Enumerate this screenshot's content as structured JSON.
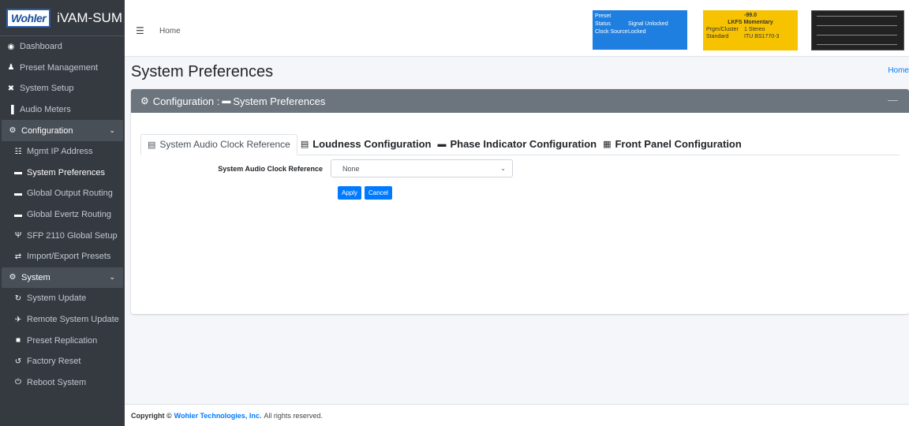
{
  "brand": {
    "logo": "Wohler",
    "name": "iVAM-SUM"
  },
  "sidebar": {
    "items": [
      {
        "label": "Dashboard",
        "icon": "dashboard-icon",
        "glyph": "◉"
      },
      {
        "label": "Preset Management",
        "icon": "users-icon",
        "glyph": "♟"
      },
      {
        "label": "System Setup",
        "icon": "tools-icon",
        "glyph": "✖"
      },
      {
        "label": "Audio Meters",
        "icon": "chart-icon",
        "glyph": "▐"
      }
    ],
    "configuration": {
      "label": "Configuration",
      "items": [
        {
          "label": "Mgmt IP Address",
          "icon": "network-icon",
          "glyph": "☷"
        },
        {
          "label": "System Preferences",
          "icon": "monitor-icon",
          "glyph": "▬"
        },
        {
          "label": "Global Output Routing",
          "icon": "monitor-icon",
          "glyph": "▬"
        },
        {
          "label": "Global Evertz Routing",
          "icon": "monitor-icon",
          "glyph": "▬"
        },
        {
          "label": "SFP 2110 Global Setup",
          "icon": "usb-icon",
          "glyph": "Ψ"
        },
        {
          "label": "Import/Export Presets",
          "icon": "exchange-icon",
          "glyph": "⇄"
        }
      ]
    },
    "system": {
      "label": "System",
      "items": [
        {
          "label": "System Update",
          "icon": "sync-icon",
          "glyph": "↻"
        },
        {
          "label": "Remote System Update",
          "icon": "satellite-icon",
          "glyph": "✈"
        },
        {
          "label": "Preset Replication",
          "icon": "copy-icon",
          "glyph": "■"
        },
        {
          "label": "Factory Reset",
          "icon": "undo-icon",
          "glyph": "↺"
        },
        {
          "label": "Reboot System",
          "icon": "power-icon",
          "glyph": "⏻"
        }
      ]
    }
  },
  "topbar": {
    "home": "Home",
    "preset": {
      "title": "Preset",
      "rows": [
        {
          "k": "Status",
          "v": "Signal Unlocked"
        },
        {
          "k": "Clock Source",
          "v": "Locked"
        }
      ],
      "color": "#1e7fe0"
    },
    "lkfs": {
      "value": "-99.0",
      "header": "LKFS   Momentary",
      "rows": [
        {
          "k": "Prgm/Cluster",
          "v": "1   Stereo"
        },
        {
          "k": "Standard",
          "v": "ITU BS1770-3"
        }
      ],
      "color": "#f7c300"
    }
  },
  "page": {
    "title": "System Preferences",
    "breadcrumb": "Home",
    "card_header_prefix": "Configuration :",
    "card_header_title": "System Preferences",
    "tabs": [
      {
        "label": "System Audio Clock Reference",
        "active": true
      },
      {
        "label": "Loudness Configuration"
      },
      {
        "label": "Phase Indicator Configuration"
      },
      {
        "label": "Front Panel Configuration"
      }
    ],
    "form": {
      "label": "System Audio Clock Reference",
      "value": "None"
    },
    "buttons": {
      "apply": "Apply",
      "cancel": "Cancel"
    }
  },
  "footer": {
    "prefix": "Copyright ©",
    "company": "Wohler Technologies, Inc.",
    "suffix": "All rights reserved."
  }
}
